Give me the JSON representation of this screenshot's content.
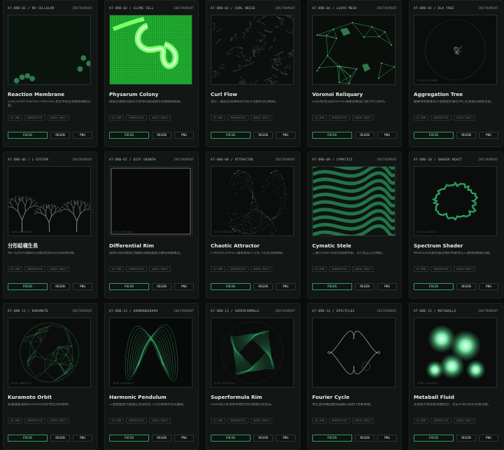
{
  "buttons": {
    "focus": "FOCUS",
    "regen": "REGEN",
    "png": "PNG"
  },
  "accent": "#39d37a",
  "cards": [
    {
      "code": "AT-ORB-01 / RD CELLULAR",
      "kind": "INSTRUMENT",
      "title": "Reaction Membrane",
      "desc": "Gray-Scott reaction–diffusion 產生學態自我複製細胞分裂。",
      "tags": [
        "AT-ORB",
        "GENERATIVE",
        "AUDIO REACT"
      ],
      "seed": ""
    },
    {
      "code": "AT-ORB-02 / SLIME CELL",
      "kind": "INSTRUMENT",
      "title": "Physarum Colony",
      "desc": "模擬多頭絨泡菌尋求食物的最短路徑有機網絡組織。",
      "tags": [
        "AT-ORB",
        "GENERATIVE",
        "AUDIO REACT"
      ],
      "seed": ""
    },
    {
      "code": "AT-ORB-03 / CURL NOISE",
      "kind": "INSTRUMENT",
      "title": "Curl Flow",
      "desc": "基於二維旋度噪聲場導引粒子流動的渦流軌跡。",
      "tags": [
        "AT-ORB",
        "GENERATIVE",
        "AUDIO REACT"
      ],
      "seed": ""
    },
    {
      "code": "AT-ORB-04 / LLOYD MESH",
      "kind": "INSTRUMENT",
      "title": "Voronoi Reliquary",
      "desc": "Lloyd鬆弛法對Voronoi細胞建構進行重力均勻排列。",
      "tags": [
        "AT-ORB",
        "GENERATIVE",
        "AUDIO REACT"
      ],
      "seed": ""
    },
    {
      "code": "AT-ORB-05 / DLA TREE",
      "kind": "INSTRUMENT",
      "title": "Aggregation Tree",
      "desc": "擴散限制聚集粒子碰撞並附著在中心生長樹的樹狀生長。",
      "tags": [
        "AT-ORB",
        "GENERATIVE",
        "AUDIO REACT"
      ],
      "seed": "SEED 03798882"
    },
    {
      "code": "AT-ORB-06 / L-SYSTEM",
      "kind": "INSTRUMENT",
      "title": "分形結構生長",
      "desc": "用L-system遞歸分支規則生長的分形植物結構。",
      "tags": [
        "AT-ORB",
        "GENERATIVE",
        "AUDIO REACT"
      ],
      "seed": "SEED 06518928"
    },
    {
      "code": "AT-ORB-07 / DIFF GROWTH",
      "kind": "INSTRUMENT",
      "title": "Differential Rim",
      "desc": "點狀的來和鄰接力驅動的細胞膜差分擴張褶皺構造。",
      "tags": [
        "AT-ORB",
        "GENERATIVE",
        "AUDIO REACT"
      ],
      "seed": "SEED 00810010"
    },
    {
      "code": "AT-ORB-08 / ATTRACTOR",
      "kind": "INSTRUMENT",
      "title": "Chaotic Attractor",
      "desc": "Clifford/Lorenz三維奇異吸子方程下的混沌軌跡線。",
      "tags": [
        "AT-ORB",
        "GENERATIVE",
        "AUDIO REACT"
      ],
      "seed": "SEED 07834213"
    },
    {
      "code": "AT-ORB-09 / CYMATICS",
      "kind": "INSTRUMENT",
      "title": "Cymatic Stele",
      "desc": "二維Chladni克拉尼圖譜共振，以行進正方形種質。",
      "tags": [
        "AT-ORB",
        "GENERATIVE",
        "AUDIO REACT"
      ],
      "seed": ""
    },
    {
      "code": "AT-ORB-10 / SHADER REACT",
      "kind": "INSTRUMENT",
      "title": "Spectrum Shader",
      "desc": "WebGL片段著色器音頻即時著色在三維頻譜數據流體。",
      "tags": [
        "AT-ORB",
        "GENERATIVE",
        "AUDIO REACT"
      ],
      "seed": "SEED 03482211"
    },
    {
      "code": "AT-ORB-11 / KURAMOTO",
      "kind": "INSTRUMENT",
      "title": "Kuramoto Orbit",
      "desc": "振盪器集落集Kuramoto同步相位漂移觀察。",
      "tags": [
        "AT-ORB",
        "GENERATIVE",
        "AUDIO REACT"
      ],
      "seed": "SEED 09003371"
    },
    {
      "code": "AT-ORB-12 / HARMONOGRAPH",
      "kind": "INSTRUMENT",
      "title": "Harmonic Pendulum",
      "desc": "三個雙擺盪力擺錘在衰減阻尼下的流暢擺和合成曲線。",
      "tags": [
        "AT-ORB",
        "GENERATIVE",
        "AUDIO REACT"
      ],
      "seed": "SEED 02158877"
    },
    {
      "code": "AT-ORB-13 / SUPERFORMULA",
      "kind": "INSTRUMENT",
      "title": "Superformula Rim",
      "desc": "Gielis超公式依據參數控制的複雜形態生成。",
      "tags": [
        "AT-ORB",
        "GENERATIVE",
        "AUDIO REACT"
      ],
      "seed": "SEED 07564228"
    },
    {
      "code": "AT-ORB-14 / EPICYCLES",
      "kind": "INSTRUMENT",
      "title": "Fourier Cycle",
      "desc": "傅立葉周轉圓疊加描繪的週期行星軌跡圖。",
      "tags": [
        "AT-ORB",
        "GENERATIVE",
        "AUDIO REACT"
      ],
      "seed": ""
    },
    {
      "code": "AT-ORB-15 / METABALLS",
      "kind": "INSTRUMENT",
      "title": "Metaball Fluid",
      "desc": "多個重力場勢能球體融合，生成平滑分裂的有機流體。",
      "tags": [
        "AT-ORB",
        "GENERATIVE",
        "AUDIO REACT"
      ],
      "seed": "SEED 04783021"
    }
  ]
}
